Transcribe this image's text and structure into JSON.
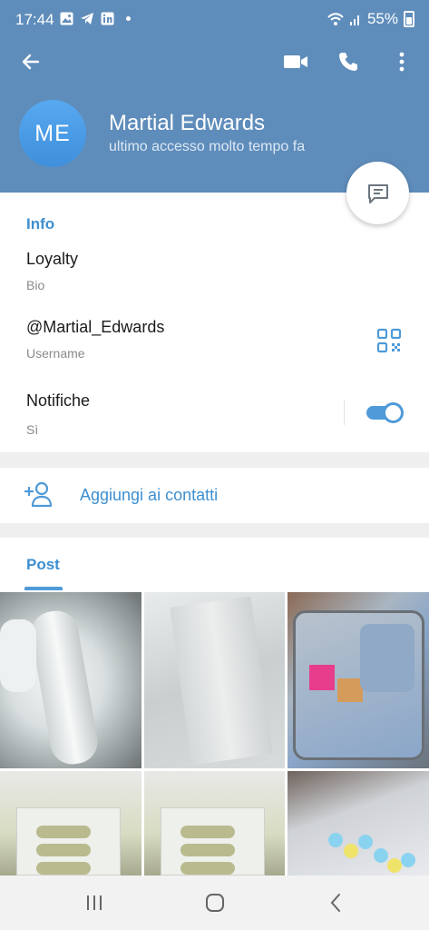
{
  "status_bar": {
    "time": "17:44",
    "battery": "55%",
    "icons": [
      "image-icon",
      "telegram-icon",
      "linkedin-icon",
      "notification-dot",
      "wifi-icon",
      "signal-icon",
      "battery-icon"
    ]
  },
  "toolbar": {
    "back_icon": "arrow-left-icon",
    "video_icon": "video-call-icon",
    "call_icon": "phone-icon",
    "more_icon": "more-vertical-icon"
  },
  "profile": {
    "initials": "ME",
    "name": "Martial Edwards",
    "status": "ultimo accesso molto tempo fa"
  },
  "info": {
    "section_title": "Info",
    "bio_value": "Loyalty",
    "bio_label": "Bio",
    "username_value": "@Martial_Edwards",
    "username_label": "Username",
    "notifications_title": "Notifiche",
    "notifications_value": "Sì",
    "notifications_enabled": true
  },
  "actions": {
    "add_contact_label": "Aggiungi ai contatti"
  },
  "posts": {
    "tab_label": "Post",
    "media_count": 6
  },
  "colors": {
    "header": "#5f8dbb",
    "accent": "#3d8fd0",
    "avatar": "#4a9ce6",
    "separator": "#efefef"
  }
}
